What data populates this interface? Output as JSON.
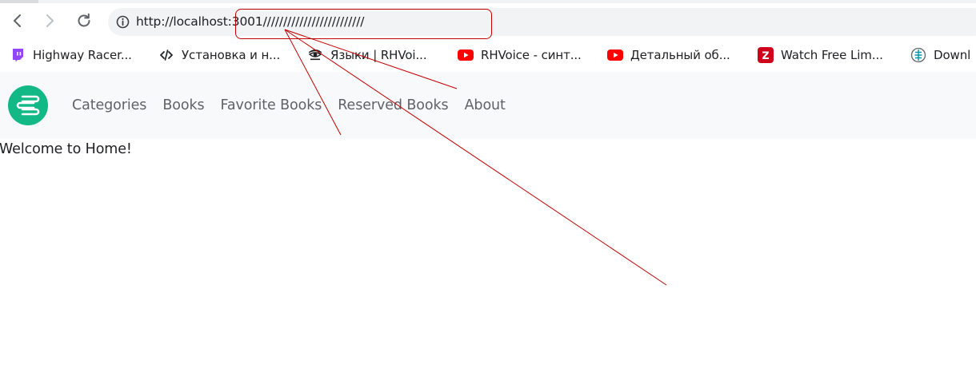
{
  "browser": {
    "address_bar": {
      "url": "http://localhost:3001/////////////////////////"
    },
    "bookmarks": [
      {
        "label": "Highway Racer...",
        "icon": "twitch-icon",
        "color": "#9146ff"
      },
      {
        "label": "Установка и н...",
        "icon": "code-icon",
        "color": "#202124"
      },
      {
        "label": "Языки | RHVoi...",
        "icon": "eye-icon",
        "color": "#202124"
      },
      {
        "label": "RHVoice - синт...",
        "icon": "youtube-icon",
        "color": "#ff0000"
      },
      {
        "label": "Детальный об...",
        "icon": "youtube-icon",
        "color": "#ff0000"
      },
      {
        "label": "Watch Free Lim...",
        "icon": "z-logo-icon",
        "color": "#d0021b"
      },
      {
        "label": "Downl",
        "icon": "globe-icon",
        "color": "#0097a7"
      }
    ]
  },
  "app": {
    "logo_color": "#12b886",
    "nav": [
      {
        "label": "Categories"
      },
      {
        "label": "Books"
      },
      {
        "label": "Favorite Books"
      },
      {
        "label": "Reserved Books"
      },
      {
        "label": "About"
      }
    ],
    "welcome_text": "Welcome to Home!"
  },
  "annotation": {
    "color": "#c00000"
  }
}
